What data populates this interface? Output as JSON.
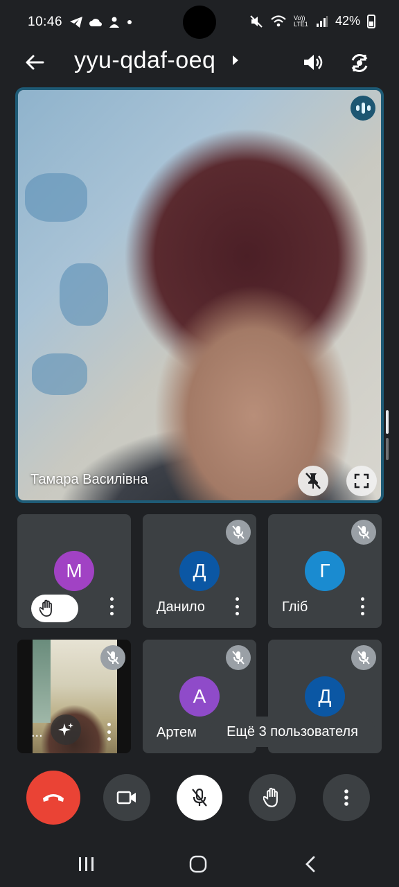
{
  "status_bar": {
    "time": "10:46",
    "left_icons": [
      "telegram-icon",
      "cloud-icon",
      "person-icon",
      "dot-icon"
    ],
    "right_icons": [
      "mute-icon",
      "wifi-icon",
      "volte-icon",
      "signal-icon"
    ],
    "volte_label": "Vo)) LTE1",
    "battery_percent": "42%"
  },
  "header": {
    "meeting_code": "yyu-qdaf-oeq"
  },
  "main_tile": {
    "participant_name": "Тамара Василівна",
    "speaking": true
  },
  "tiles": [
    {
      "avatar_letter": "М",
      "avatar_color": "#a142c4",
      "name": "",
      "hand_raised": true,
      "muted": false
    },
    {
      "avatar_letter": "Д",
      "avatar_color": "#0b57a4",
      "name": "Данило",
      "hand_raised": false,
      "muted": true
    },
    {
      "avatar_letter": "Г",
      "avatar_color": "#1a8bd0",
      "name": "Гліб",
      "hand_raised": false,
      "muted": true
    },
    {
      "avatar_letter": "",
      "avatar_color": "",
      "name": "...",
      "self_view": true,
      "muted": true
    },
    {
      "avatar_letter": "А",
      "avatar_color": "#8f4bc9",
      "name": "Артем",
      "hand_raised": false,
      "muted": true
    },
    {
      "avatar_letter": "Д",
      "avatar_color": "#0b57a4",
      "name": "",
      "hand_raised": false,
      "muted": true
    }
  ],
  "more_users_label": "Ещё 3 пользователя",
  "colors": {
    "background": "#1f2124",
    "tile": "#3c4043",
    "active_border": "#1e5b76",
    "end_call": "#ea4335"
  },
  "controls": [
    "end-call",
    "camera",
    "microphone-muted",
    "raise-hand",
    "more-options"
  ],
  "nav": [
    "recents",
    "home",
    "back"
  ]
}
